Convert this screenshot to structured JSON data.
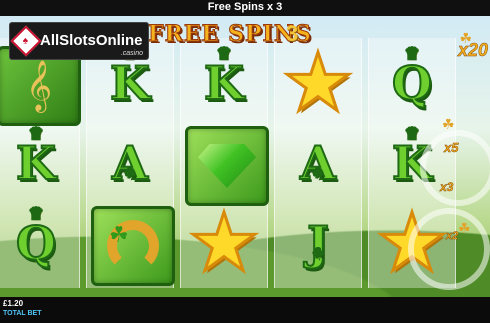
{
  "header": {
    "title": "Free Spins x 3"
  },
  "logo": {
    "text": "AllSlotsOnline",
    "suffix": ".casino",
    "badge": "♠"
  },
  "game": {
    "title": "FREE SPINS",
    "spins_remaining": "3",
    "multipliers": [
      "x20",
      "x5",
      "x3",
      "x2"
    ]
  },
  "reels": [
    {
      "symbols": [
        "harp",
        "K",
        "Q"
      ]
    },
    {
      "symbols": [
        "K",
        "A",
        "horseshoe"
      ]
    },
    {
      "symbols": [
        "K",
        "gem",
        "star"
      ]
    },
    {
      "symbols": [
        "star",
        "A",
        "J"
      ]
    },
    {
      "symbols": [
        "Q",
        "K",
        "star"
      ]
    }
  ],
  "footer": {
    "total_bet_value": "£1.20",
    "total_bet_label": "TOTAL BET"
  },
  "colors": {
    "letter_green": "#6fcf2f",
    "star_gold": "#ffd92a",
    "title_orange": "#f5b21c",
    "bet_label_blue": "#4fc3f7"
  }
}
